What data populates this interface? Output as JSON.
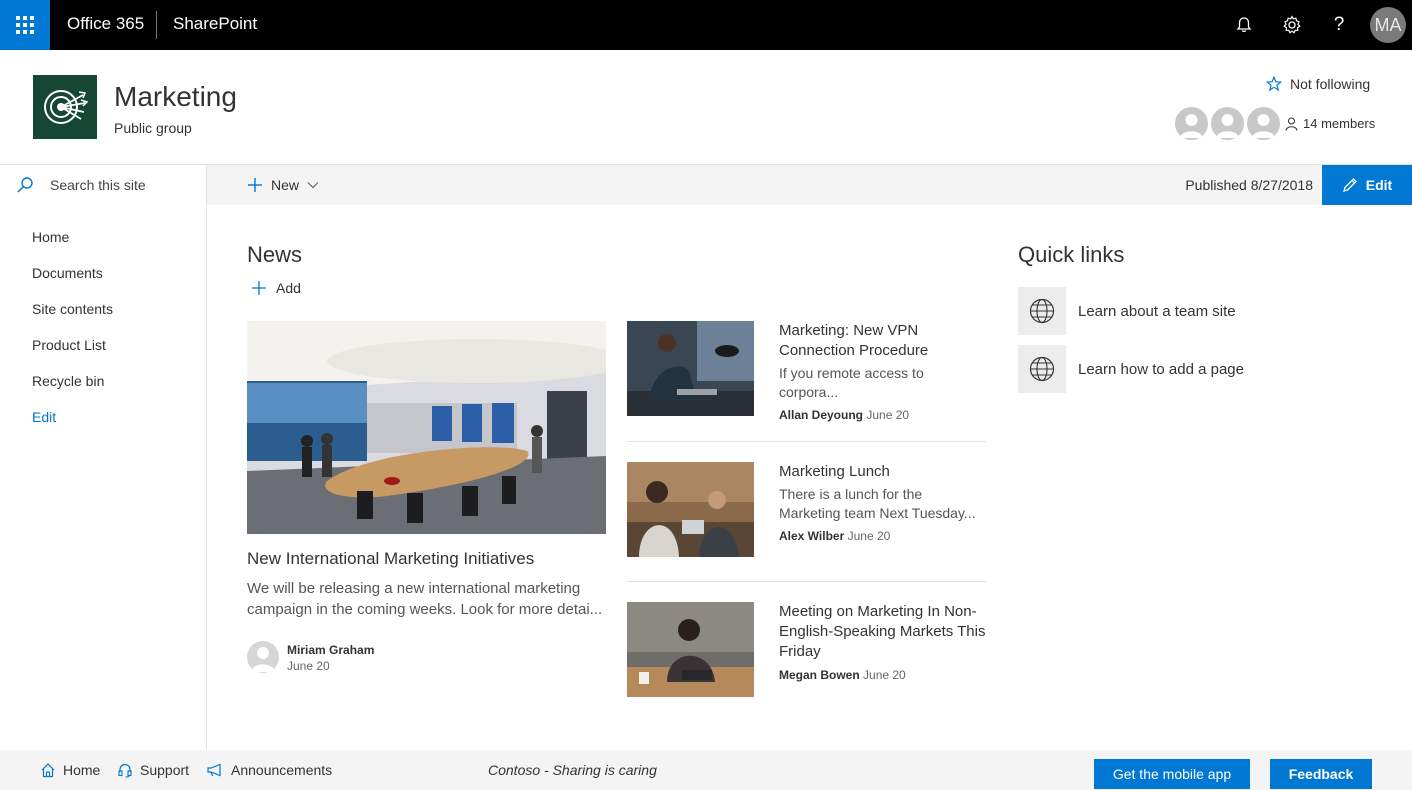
{
  "suite": {
    "brand": "Office 365",
    "app": "SharePoint",
    "user_initials": "MA"
  },
  "site": {
    "title": "Marketing",
    "subtitle": "Public group",
    "follow_label": "Not following",
    "members_label": "14 members"
  },
  "search": {
    "placeholder": "Search this site"
  },
  "command_bar": {
    "new_label": "New",
    "published": "Published 8/27/2018",
    "edit_label": "Edit"
  },
  "nav": {
    "items": [
      "Home",
      "Documents",
      "Site contents",
      "Product List",
      "Recycle bin",
      "Edit"
    ]
  },
  "news": {
    "title": "News",
    "add_label": "Add",
    "hero": {
      "title": "New International Marketing Initiatives",
      "description": "We will be releasing a new international marketing campaign in the coming weeks. Look for more detai...",
      "author": "Miriam Graham",
      "date": "June 20"
    },
    "items": [
      {
        "title": "Marketing: New VPN Connection Procedure",
        "description": "If you remote access to corpora...",
        "author": "Allan Deyoung",
        "date": "June 20"
      },
      {
        "title": "Marketing Lunch",
        "description": "There is a lunch for the Marketing team Next Tuesday...",
        "author": "Alex Wilber",
        "date": "June 20"
      },
      {
        "title": "Meeting on Marketing In Non-English-Speaking Markets This Friday",
        "description": "",
        "author": "Megan Bowen",
        "date": "June 20"
      }
    ]
  },
  "quick_links": {
    "title": "Quick links",
    "items": [
      "Learn about a team site",
      "Learn how to add a page"
    ]
  },
  "footer": {
    "links": [
      "Home",
      "Support",
      "Announcements"
    ],
    "message": "Contoso - Sharing is caring",
    "mobile_app_label": "Get the mobile app",
    "feedback_label": "Feedback"
  },
  "colors": {
    "accent": "#0078d4",
    "suite_bar": "#000000",
    "logo_bg": "#154734"
  }
}
